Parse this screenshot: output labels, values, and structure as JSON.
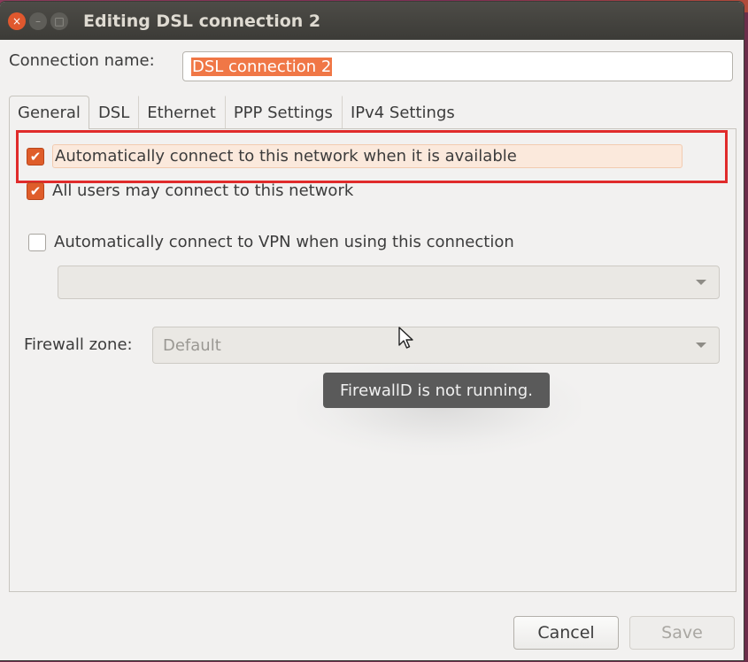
{
  "window": {
    "title": "Editing DSL connection 2",
    "controls": {
      "close": "×",
      "minimize": "–",
      "maximize": "□"
    }
  },
  "connection": {
    "label": "Connection name:",
    "value": "DSL connection 2"
  },
  "tabs": [
    {
      "label": "General",
      "active": true
    },
    {
      "label": "DSL",
      "active": false
    },
    {
      "label": "Ethernet",
      "active": false
    },
    {
      "label": "PPP Settings",
      "active": false
    },
    {
      "label": "IPv4 Settings",
      "active": false
    }
  ],
  "general": {
    "auto_connect": {
      "label": "Automatically connect to this network when it is available",
      "checked": true
    },
    "all_users": {
      "label": "All users may connect to this network",
      "checked": true
    },
    "auto_vpn": {
      "label": "Automatically connect to VPN when using this connection",
      "checked": false
    },
    "vpn_select": {
      "value": ""
    },
    "firewall": {
      "label": "Firewall zone:",
      "value": "Default"
    },
    "tooltip": "FirewallD is not running."
  },
  "buttons": {
    "cancel": "Cancel",
    "save": "Save"
  },
  "colors": {
    "accent": "#df5d2a",
    "highlight_box": "#e02b2b",
    "titlebar": "#3c3b37"
  }
}
